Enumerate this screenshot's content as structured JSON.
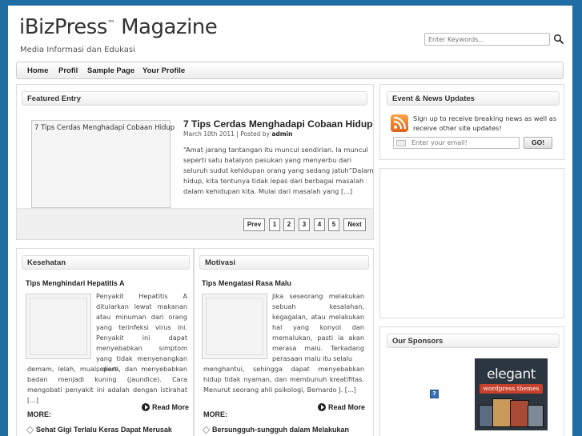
{
  "header": {
    "title": "iBizPress",
    "trademark": "™",
    "title_suffix": " Magazine",
    "tagline": "Media Informasi dan Edukasi",
    "search_placeholder": "Enter Keywords..."
  },
  "nav": {
    "items": [
      {
        "label": "Home"
      },
      {
        "label": "Profil"
      },
      {
        "label": "Sample Page"
      },
      {
        "label": "Your Profile"
      }
    ]
  },
  "featured": {
    "heading": "Featured Entry",
    "thumb_alt": "7 Tips Cerdas Menghadapi Cobaan Hidup",
    "title": "7 Tips Cerdas Menghadapi Cobaan Hidup",
    "date": "March 10th 2011",
    "posted_by_label": " | Posted by ",
    "author": "admin",
    "excerpt": "“Amat jarang tantangan itu muncul sendirian. Ia muncul seperti satu batalyon pasukan yang menyerbu dari seluruh sudut kehidupan orang yang sedang jatuh”Dalam hidup, kita tentunya tidak lepas dari berbagai masalah dalam kehidupan kita. Mulai dari masalah yang [...]",
    "pager": {
      "prev": "Prev",
      "pages": [
        "1",
        "2",
        "3",
        "4",
        "5"
      ],
      "next": "Next"
    }
  },
  "categories": [
    {
      "heading": "Kesehatan",
      "post_title": "Tips Menghindari Hepatitis A",
      "excerpt_side": "Penyakit Hepatitis A ditularkan lewat makanan atau minuman dari orang yang terinfeksi virus ini. Penyakit ini dapat menyebabkan simptom yang tidak menyenangkan seperti",
      "excerpt_full": "demam, lelah, mual, diare, dan menyebabkan badan menjadi kuning (jaundice). Cara mengobati penyakit ini adalah dengan istirahat [...]",
      "read_more": "Read More",
      "more_label": "MORE:",
      "more_link": "Sehat Gigi Terlalu Keras Dapat Merusak"
    },
    {
      "heading": "Motivasi",
      "post_title": "Tips Mengatasi Rasa Malu",
      "excerpt_side": "Jika seseorang melakukan sebuah kesalahan, kegagalan, atau melakukan hal yang konyol dan memalukan, pasti ia akan merasa malu. Terkadang perasaan malu itu selalu",
      "excerpt_full": "menghantui, sehingga dapat menyebabkan hidup tidak nyaman, dan membunuh kreatifitas. Menurut seorang ahli psikologi, Bernardo J. [...]",
      "read_more": "Read More",
      "more_label": "MORE:",
      "more_link": "Bersungguh-sungguh dalam Melakukan"
    }
  ],
  "sidebar": {
    "events": {
      "heading": "Event & News Updates",
      "signup_text": "Sign up to receive breaking news as well as receive other site updates!",
      "email_placeholder": "Enter your email!",
      "go_label": "GO!"
    },
    "sponsors": {
      "heading": "Our Sponsors",
      "broken_image_glyph": "?",
      "ad_brand": "elegant",
      "ad_tagline": "wordpress themes"
    }
  },
  "colors": {
    "background": "#1f6ea3",
    "rss": "#e2621b",
    "ad_bg": "#2b3640",
    "ad_accent": "#c8412c"
  }
}
